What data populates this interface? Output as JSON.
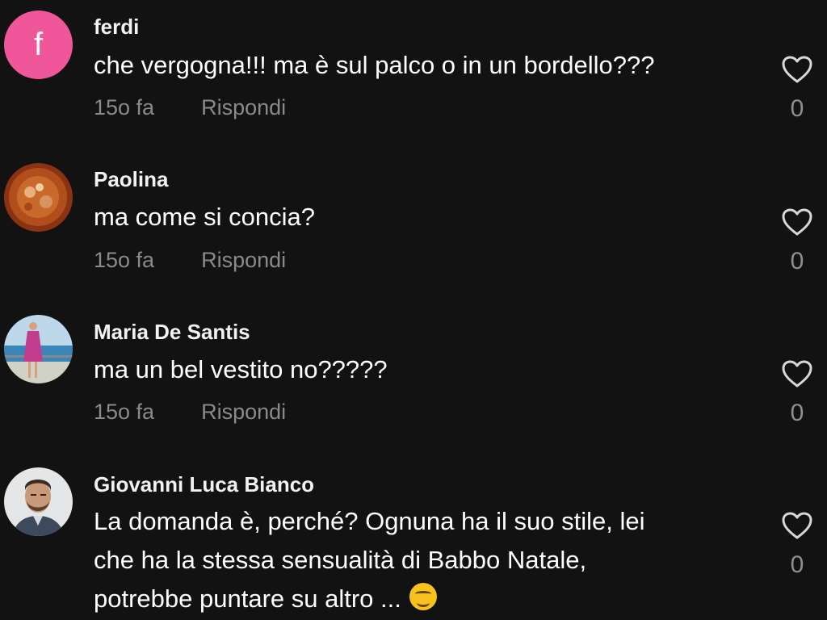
{
  "comments": [
    {
      "username": "ferdi",
      "avatar_letter": "f",
      "text": "che vergogna!!! ma è sul palco o in un bordello???",
      "time": "15o fa",
      "reply_label": "Rispondi",
      "likes": "0"
    },
    {
      "username": "Paolina",
      "text": "ma come si concia?",
      "time": "15o fa",
      "reply_label": "Rispondi",
      "likes": "0"
    },
    {
      "username": "Maria De Santis",
      "text": "ma un bel vestito no?????",
      "time": "15o fa",
      "reply_label": "Rispondi",
      "likes": "0"
    },
    {
      "username": "Giovanni Luca Bianco",
      "text_line1": "La domanda è, perché? Ognuna ha il suo stile, lei",
      "text_line2": "che ha la stessa sensualità di Babbo Natale,",
      "text_line3": "potrebbe puntare su altro ...",
      "emoji": "smirking-face-emoji",
      "likes": "0"
    }
  ],
  "colors": {
    "background": "#121212",
    "avatar_pink": "#f0569a",
    "meta_gray": "#8a8a8a"
  }
}
